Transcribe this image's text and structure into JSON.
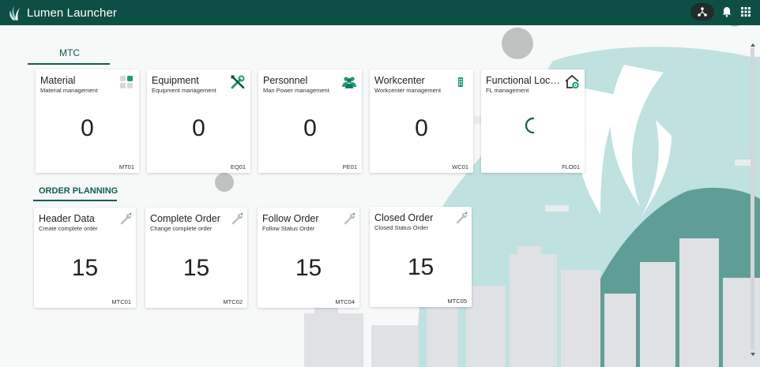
{
  "header": {
    "title": "Lumen Launcher",
    "icons": [
      "leaf-logo",
      "network-icon",
      "bell-icon",
      "grid-icon"
    ],
    "brand_color": "#0d4f45"
  },
  "sections": [
    {
      "label": "MTC",
      "tiles": [
        {
          "title": "Material",
          "subtitle": "Material management",
          "value": "0",
          "code": "MT01",
          "icon": "blocks-icon"
        },
        {
          "title": "Equipment",
          "subtitle": "Equipment management",
          "value": "0",
          "code": "EQ01",
          "icon": "tools-icon"
        },
        {
          "title": "Personnel",
          "subtitle": "Man Power management",
          "value": "0",
          "code": "PE01",
          "icon": "people-icon"
        },
        {
          "title": "Workcenter",
          "subtitle": "Workcenter management",
          "value": "0",
          "code": "WC01",
          "icon": "building-icon"
        },
        {
          "title": "Functional Location",
          "subtitle": "FL management",
          "value": "",
          "code": "FLO01",
          "icon": "home-settings-icon",
          "loading": true
        }
      ]
    },
    {
      "label": "ORDER PLANNING",
      "tiles": [
        {
          "title": "Header Data",
          "subtitle": "Create complete order",
          "value": "15",
          "code": "MTC01",
          "icon": "wrench-icon"
        },
        {
          "title": "Complete Order",
          "subtitle": "Change complete order",
          "value": "15",
          "code": "MTC02",
          "icon": "wrench-icon"
        },
        {
          "title": "Follow Order",
          "subtitle": "Follow Status Order",
          "value": "15",
          "code": "MTC04",
          "icon": "wrench-icon"
        },
        {
          "title": "Closed Order",
          "subtitle": "Closed Status Order",
          "value": "15",
          "code": "MTC05",
          "icon": "wrench-icon"
        }
      ]
    }
  ],
  "colors": {
    "accent": "#115c52",
    "icon_green": "#1a9e78",
    "bg_teal_light": "#bfe1df",
    "bg_teal_dark": "#5e9e97",
    "bg_city": "#dfe1e4"
  }
}
